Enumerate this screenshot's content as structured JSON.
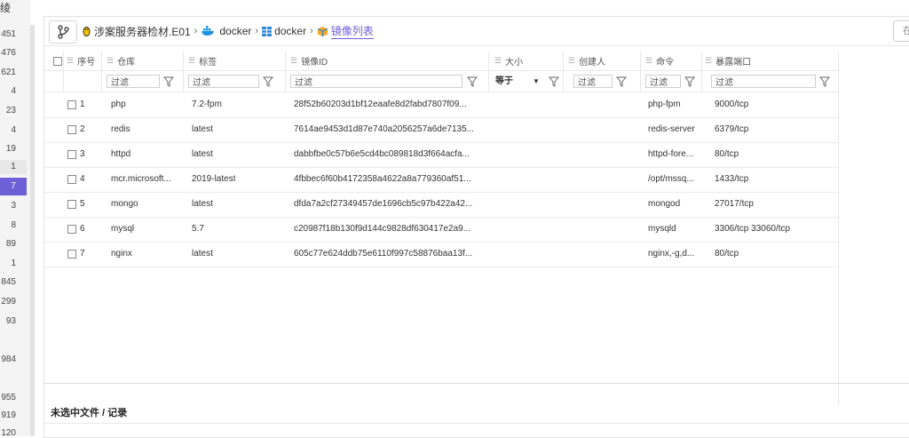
{
  "gutter": {
    "top_char": "绫",
    "numbers": [
      "451",
      "476",
      "621",
      "4",
      "23",
      "4",
      "19",
      "1",
      "7",
      "3",
      "8",
      "89",
      "1",
      "845",
      "299",
      "93",
      "984",
      "955",
      "919",
      "120"
    ]
  },
  "breadcrumb": {
    "items": [
      {
        "label": "涉案服务器检材.E01",
        "icon": "linux-icon"
      },
      {
        "label": "docker",
        "icon": "docker-icon"
      },
      {
        "label": "docker",
        "icon": "grid-icon"
      },
      {
        "label": "镜像列表",
        "icon": "cube-icon",
        "active": true
      }
    ],
    "right_button": "在"
  },
  "table": {
    "headers": {
      "index": "序号",
      "repo": "仓库",
      "tag": "标签",
      "image_id": "镜像ID",
      "size": "大小",
      "creator": "创建人",
      "command": "命令",
      "ports": "暴露端口"
    },
    "filter_placeholder": "过滤",
    "size_operator": "等于",
    "rows": [
      {
        "index": "1",
        "repo": "php",
        "tag": "7.2-fpm",
        "image_id": "28f52b60203d1bf12eaafe8d2fabd7807f09...",
        "size": "",
        "creator": "",
        "command": "php-fpm",
        "ports": "9000/tcp"
      },
      {
        "index": "2",
        "repo": "redis",
        "tag": "latest",
        "image_id": "7614ae9453d1d87e740a2056257a6de7135...",
        "size": "",
        "creator": "",
        "command": "redis-server",
        "ports": "6379/tcp"
      },
      {
        "index": "3",
        "repo": "httpd",
        "tag": "latest",
        "image_id": "dabbfbe0c57b6e5cd4bc089818d3f664acfa...",
        "size": "",
        "creator": "",
        "command": "httpd-fore...",
        "ports": "80/tcp"
      },
      {
        "index": "4",
        "repo": "mcr.microsoft...",
        "tag": "2019-latest",
        "image_id": "4fbbec6f60b4172358a4622a8a779360af51...",
        "size": "",
        "creator": "",
        "command": "/opt/mssq...",
        "ports": "1433/tcp"
      },
      {
        "index": "5",
        "repo": "mongo",
        "tag": "latest",
        "image_id": "dfda7a2cf27349457de1696cb5c97b422a42...",
        "size": "",
        "creator": "",
        "command": "mongod",
        "ports": "27017/tcp"
      },
      {
        "index": "6",
        "repo": "mysql",
        "tag": "5.7",
        "image_id": "c20987f18b130f9d144c9828df630417e2a9...",
        "size": "",
        "creator": "",
        "command": "mysqld",
        "ports": "3306/tcp 33060/tcp"
      },
      {
        "index": "7",
        "repo": "nginx",
        "tag": "latest",
        "image_id": "605c77e624ddb75e6110f997c58876baa13f...",
        "size": "",
        "creator": "",
        "command": "nginx,-g,d...",
        "ports": "80/tcp"
      }
    ]
  },
  "status": {
    "text": "未选中文件 / 记录"
  },
  "colors": {
    "accent": "#6d5fd6"
  }
}
